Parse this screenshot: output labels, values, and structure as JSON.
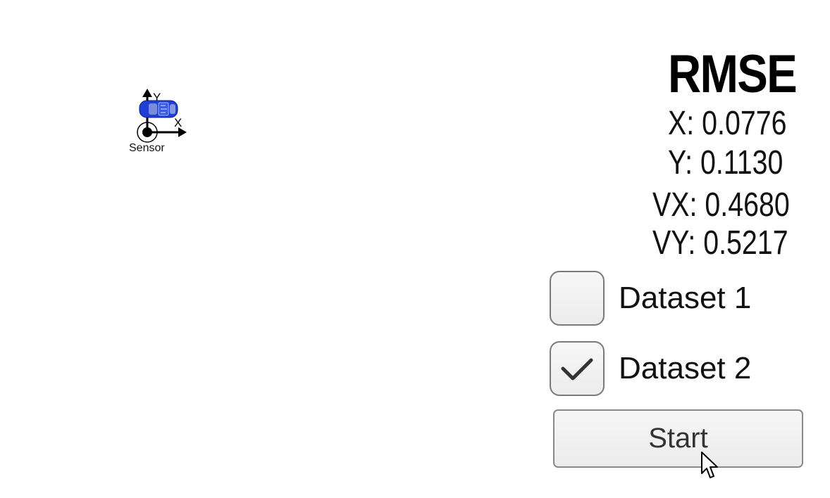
{
  "scene": {
    "sensor_label": "Sensor",
    "x_axis_label": "X",
    "y_axis_label": "Y",
    "car_color": "#1f3fd6"
  },
  "rmse": {
    "title": "RMSE",
    "x_line": "X: 0.0776",
    "y_line": "Y: 0.1130",
    "vx_line": "VX: 0.4680",
    "vy_line": "VY: 0.5217"
  },
  "datasets": [
    {
      "label": "Dataset 1",
      "checked": false
    },
    {
      "label": "Dataset 2",
      "checked": true
    }
  ],
  "start_button": {
    "label": "Start"
  },
  "icons": {
    "checkmark": "checkmark-icon",
    "cursor": "mouse-pointer-icon",
    "car": "car-icon"
  }
}
